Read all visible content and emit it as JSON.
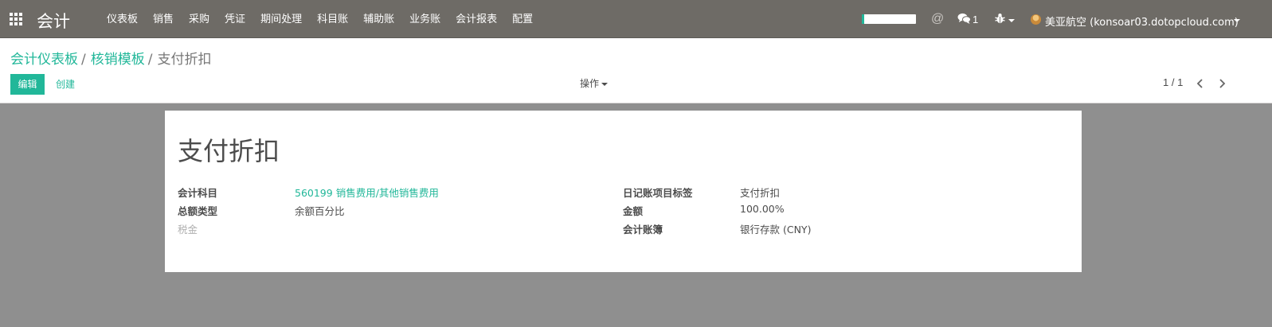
{
  "navbar": {
    "app_title": "会计",
    "menu": [
      "仪表板",
      "销售",
      "采购",
      "凭证",
      "期间处理",
      "科目账",
      "辅助账",
      "业务账",
      "会计报表",
      "配置"
    ],
    "progress_fraction": 0.05,
    "messages_count": "1",
    "user": "美亚航空 (konsoar03.dotopcloud.com)",
    "accent_color": "#21b799",
    "bar_color": "#6e6b66"
  },
  "breadcrumb": {
    "items": [
      "会计仪表板",
      "核销模板"
    ],
    "current": "支付折扣"
  },
  "buttons": {
    "edit": "编辑",
    "create": "创建",
    "actions": "操作"
  },
  "pager": {
    "value": "1 / 1"
  },
  "record": {
    "title": "支付折扣",
    "left": {
      "account_label": "会计科目",
      "account_value": "560199 销售费用/其他销售费用",
      "amount_type_label": "总额类型",
      "amount_type_value": "余额百分比",
      "tax_label": "税金"
    },
    "right": {
      "journal_item_label_label": "日记账项目标签",
      "journal_item_label_value": "支付折扣",
      "amount_label": "金额",
      "amount_value": "100.00%",
      "journal_label": "会计账簿",
      "journal_value": "银行存款 (CNY)"
    }
  }
}
